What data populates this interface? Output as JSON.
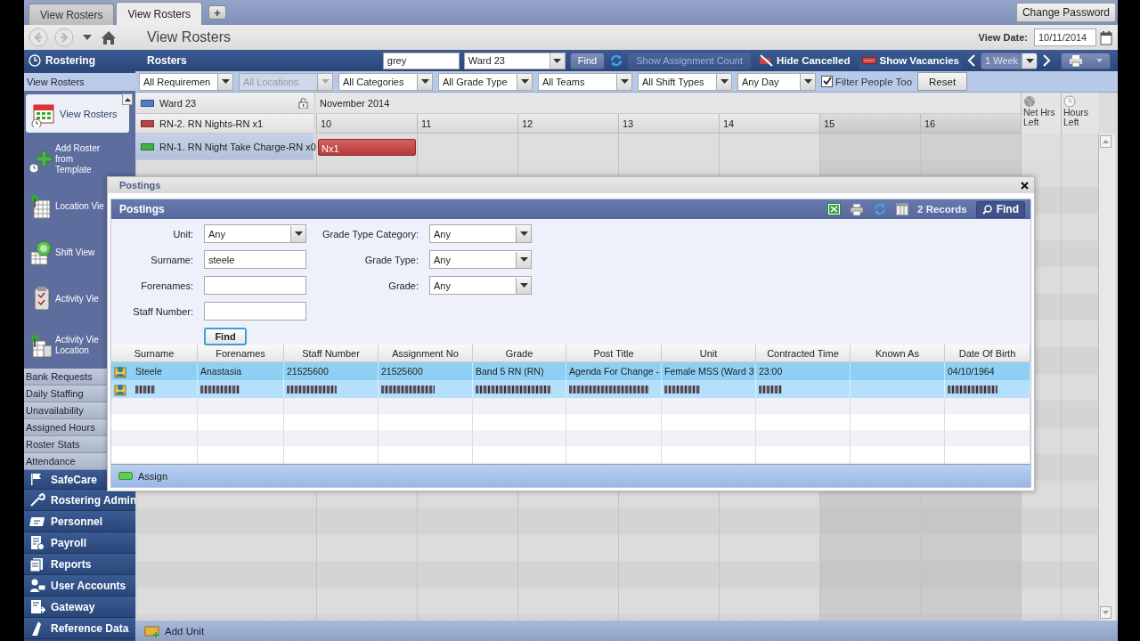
{
  "tabs": [
    {
      "label": "View Rosters",
      "selected": false
    },
    {
      "label": "View Rosters",
      "selected": true
    }
  ],
  "new_tab": "+",
  "change_password": "Change Password",
  "toolbar": {
    "title": "View Rosters",
    "view_date_label": "View Date:",
    "view_date": "10/11/2014"
  },
  "sidebar": {
    "header": "Rostering",
    "current": "View Rosters",
    "big_items": [
      {
        "label": "View Rosters",
        "selected": true
      },
      {
        "label": "Add Roster from Template",
        "selected": false
      },
      {
        "label": "Location Vie",
        "selected": false
      },
      {
        "label": "Shift View",
        "selected": false
      },
      {
        "label": "Activity Vie",
        "selected": false
      },
      {
        "label": "Activity Vie Location",
        "selected": false
      }
    ],
    "sub_items": [
      "Bank Requests",
      "Daily Staffing",
      "Unavailability",
      "Assigned Hours",
      "Roster Stats",
      "Attendance"
    ],
    "sections": [
      "SafeCare",
      "Rostering Admin",
      "Personnel",
      "Payroll",
      "Reports",
      "User Accounts",
      "Gateway",
      "Reference Data"
    ]
  },
  "rosters": {
    "title": "Rosters",
    "search": "grey",
    "ward": "Ward 23",
    "find": "Find",
    "show_assignment_count": {
      "label": "Show Assignment Count",
      "disabled": true
    },
    "hide_cancelled": "Hide Cancelled",
    "show_vacancies": "Show Vacancies",
    "period": "1 Week",
    "filters": [
      {
        "label": "All Requiremen",
        "disabled": false
      },
      {
        "label": "All Locations",
        "disabled": true
      },
      {
        "label": "All Categories",
        "disabled": false
      },
      {
        "label": "All Grade Type",
        "disabled": false
      },
      {
        "label": "All Teams",
        "disabled": false
      },
      {
        "label": "All Shift Types",
        "disabled": false
      },
      {
        "label": "Any Day",
        "disabled": false
      }
    ],
    "filter_people_too": {
      "label": "Filter People Too",
      "checked": true
    },
    "reset": "Reset",
    "month": "November 2014",
    "days": [
      {
        "label": "10",
        "weekend": false
      },
      {
        "label": "11",
        "weekend": false
      },
      {
        "label": "12",
        "weekend": false
      },
      {
        "label": "13",
        "weekend": false
      },
      {
        "label": "14",
        "weekend": false
      },
      {
        "label": "15",
        "weekend": true
      },
      {
        "label": "16",
        "weekend": true
      }
    ],
    "summary_columns": [
      "Net Hrs Left",
      "Hours Left"
    ],
    "rows": [
      {
        "kind": "unit",
        "label": "Ward 23",
        "color": "#4f7bc8"
      },
      {
        "kind": "requirement",
        "label": "RN-2. RN Nights-RN x1",
        "color": "#b84444"
      },
      {
        "kind": "requirement",
        "label": "RN-1. RN Night Take Charge-RN x0",
        "color": "#3fb34a",
        "shifts": [
          {
            "booked": true,
            "label": "Nx1"
          },
          {
            "booked": false
          },
          {
            "booked": false
          },
          {
            "booked": false
          },
          {
            "booked": false
          },
          {
            "booked": false
          },
          {
            "booked": false
          }
        ]
      }
    ],
    "add_unit": "Add Unit"
  },
  "postings": {
    "window_title": "Postings",
    "panel_title": "Postings",
    "records": "2 Records",
    "find": "Find",
    "fields": [
      {
        "label": "Unit:",
        "kind": "select",
        "value": "Any"
      },
      {
        "label": "Surname:",
        "kind": "text",
        "value": "steele"
      },
      {
        "label": "Forenames:",
        "kind": "text"
      },
      {
        "label": "Staff Number:",
        "kind": "text"
      }
    ],
    "fields_right": [
      {
        "label": "Grade Type Category:",
        "kind": "select",
        "value": "Any"
      },
      {
        "label": "Grade Type:",
        "kind": "select",
        "value": "Any"
      },
      {
        "label": "Grade:",
        "kind": "select",
        "value": "Any"
      }
    ],
    "find_button": "Find",
    "columns": [
      "Surname",
      "Forenames",
      "Staff Number",
      "Assignment No",
      "Grade",
      "Post Title",
      "Unit",
      "Contracted Time",
      "Known As",
      "Date Of Birth"
    ],
    "rows": [
      {
        "kind": "text",
        "selected": true,
        "cells": [
          "Steele",
          "Anastasia",
          "21525600",
          "21525600",
          "Band 5 RN (RN)",
          "Agenda For Change -",
          "Female MSS (Ward 3",
          "23:00",
          null,
          "04/10/1964"
        ]
      },
      {
        "kind": "redacted",
        "selected": false,
        "filled": [
          true,
          true,
          true,
          true,
          true,
          true,
          true,
          true,
          false,
          true
        ]
      }
    ],
    "assign": "Assign"
  }
}
